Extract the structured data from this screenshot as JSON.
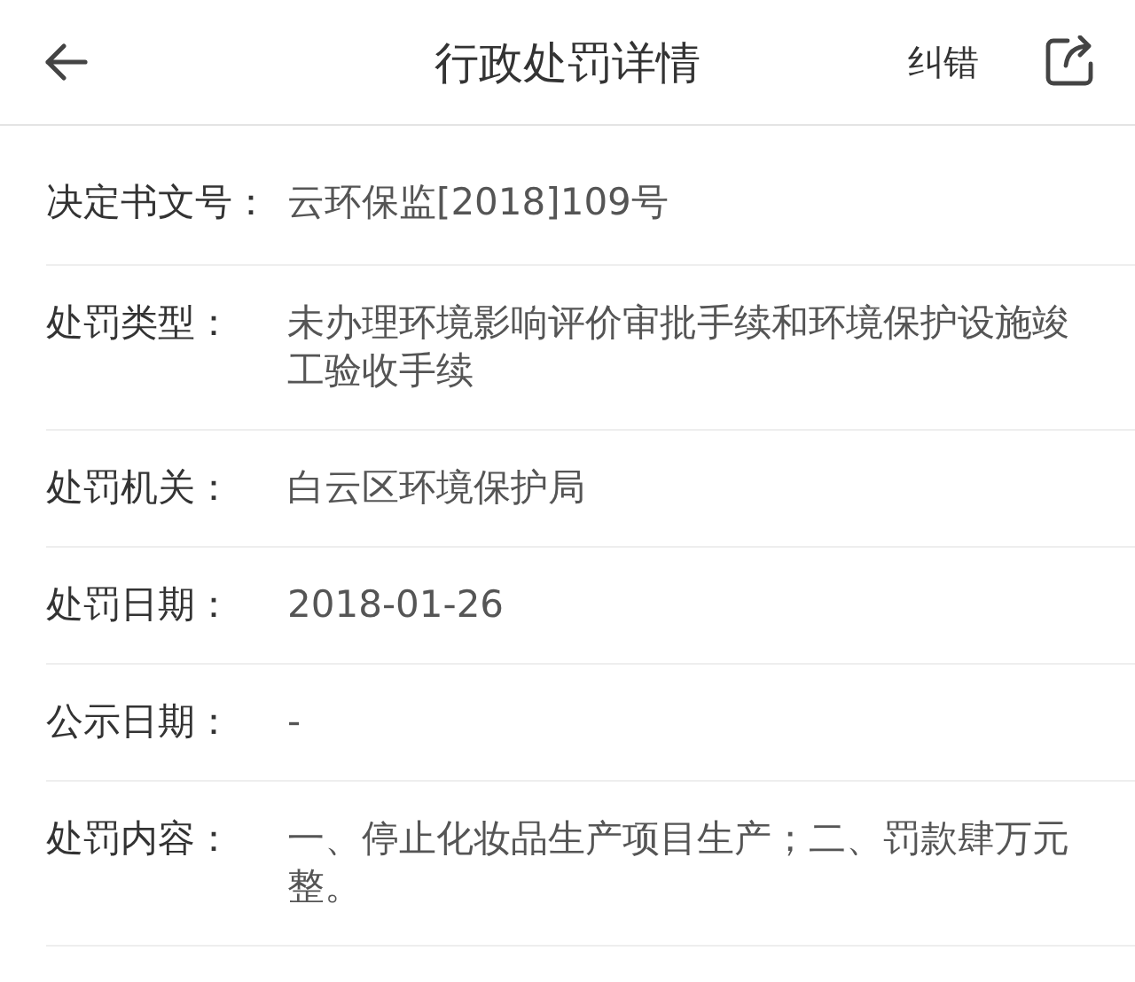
{
  "header": {
    "title": "行政处罚详情",
    "action": "纠错"
  },
  "fields": [
    {
      "label": "决定书文号：",
      "value": "云环保监[2018]109号"
    },
    {
      "label": "处罚类型：",
      "value": "未办理环境影响评价审批手续和环境保护设施竣工验收手续"
    },
    {
      "label": "处罚机关：",
      "value": "白云区环境保护局"
    },
    {
      "label": "处罚日期：",
      "value": "2018-01-26"
    },
    {
      "label": "公示日期：",
      "value": "-"
    },
    {
      "label": "处罚内容：",
      "value": "一、停止化妆品生产项目生产；二、罚款肆万元整。"
    }
  ]
}
